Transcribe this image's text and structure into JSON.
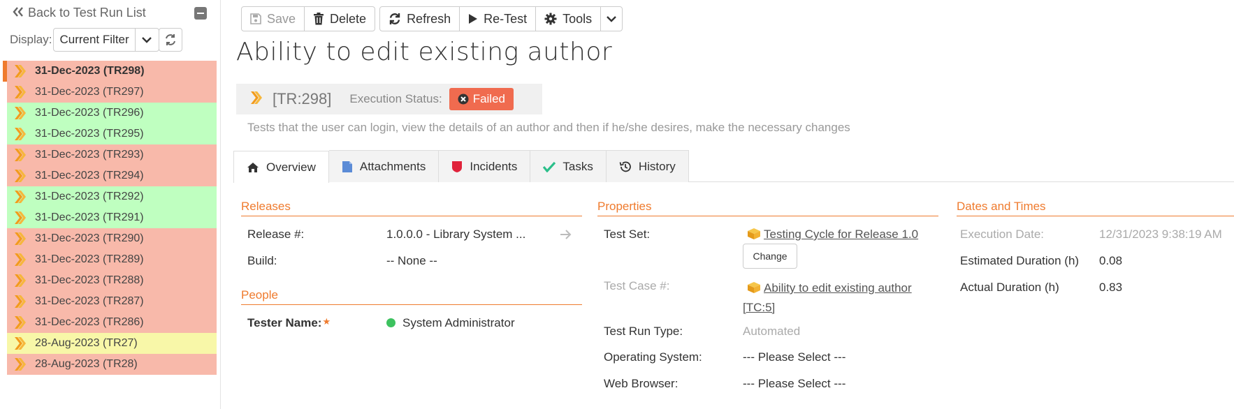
{
  "sidebar": {
    "back_label": "Back to Test Run List",
    "display_label": "Display:",
    "filter_value": "Current Filter",
    "runs": [
      {
        "label": "31-Dec-2023 (TR298)",
        "status": "red",
        "active": true
      },
      {
        "label": "31-Dec-2023 (TR297)",
        "status": "red"
      },
      {
        "label": "31-Dec-2023 (TR296)",
        "status": "green"
      },
      {
        "label": "31-Dec-2023 (TR295)",
        "status": "green"
      },
      {
        "label": "31-Dec-2023 (TR293)",
        "status": "red"
      },
      {
        "label": "31-Dec-2023 (TR294)",
        "status": "red"
      },
      {
        "label": "31-Dec-2023 (TR292)",
        "status": "green"
      },
      {
        "label": "31-Dec-2023 (TR291)",
        "status": "green"
      },
      {
        "label": "31-Dec-2023 (TR290)",
        "status": "red"
      },
      {
        "label": "31-Dec-2023 (TR289)",
        "status": "red"
      },
      {
        "label": "31-Dec-2023 (TR288)",
        "status": "red"
      },
      {
        "label": "31-Dec-2023 (TR287)",
        "status": "red"
      },
      {
        "label": "31-Dec-2023 (TR286)",
        "status": "red"
      },
      {
        "label": "28-Aug-2023 (TR27)",
        "status": "yellow"
      },
      {
        "label": "28-Aug-2023 (TR28)",
        "status": "red"
      }
    ]
  },
  "toolbar": {
    "save": "Save",
    "delete": "Delete",
    "refresh": "Refresh",
    "retest": "Re-Test",
    "tools": "Tools"
  },
  "page": {
    "title": "Ability to edit existing author",
    "tr_id": "[TR:298]",
    "exec_status_label": "Execution Status:",
    "exec_status": "Failed",
    "description": "Tests that the user can login, view the details of an author and then if he/she desires, make the necessary changes"
  },
  "tabs": [
    "Overview",
    "Attachments",
    "Incidents",
    "Tasks",
    "History"
  ],
  "releases": {
    "header": "Releases",
    "release_label": "Release #:",
    "release_value": "1.0.0.0 - Library System ...",
    "build_label": "Build:",
    "build_value": "-- None --"
  },
  "people": {
    "header": "People",
    "tester_label": "Tester Name:",
    "tester_value": "System Administrator"
  },
  "properties": {
    "header": "Properties",
    "test_set_label": "Test Set:",
    "test_set_value": "Testing Cycle for Release 1.0",
    "change_label": "Change",
    "test_case_label": "Test Case #:",
    "test_case_value": "Ability to edit existing author",
    "test_case_id": "[TC:5]",
    "run_type_label": "Test Run Type:",
    "run_type_value": "Automated",
    "os_label": "Operating System:",
    "os_value": "--- Please Select ---",
    "browser_label": "Web Browser:",
    "browser_value": "--- Please Select ---"
  },
  "dates": {
    "header": "Dates and Times",
    "exec_date_label": "Execution Date:",
    "exec_date_value": "12/31/2023 9:38:19 AM",
    "est_label": "Estimated Duration (h)",
    "est_value": "0.08",
    "actual_label": "Actual Duration (h)",
    "actual_value": "0.83"
  },
  "colors": {
    "accent": "#ef7b2e",
    "failed": "#f06b4f",
    "row_failed": "#f8b9aa",
    "row_passed": "#bfffc0",
    "row_blocked": "#f8f7a8"
  }
}
